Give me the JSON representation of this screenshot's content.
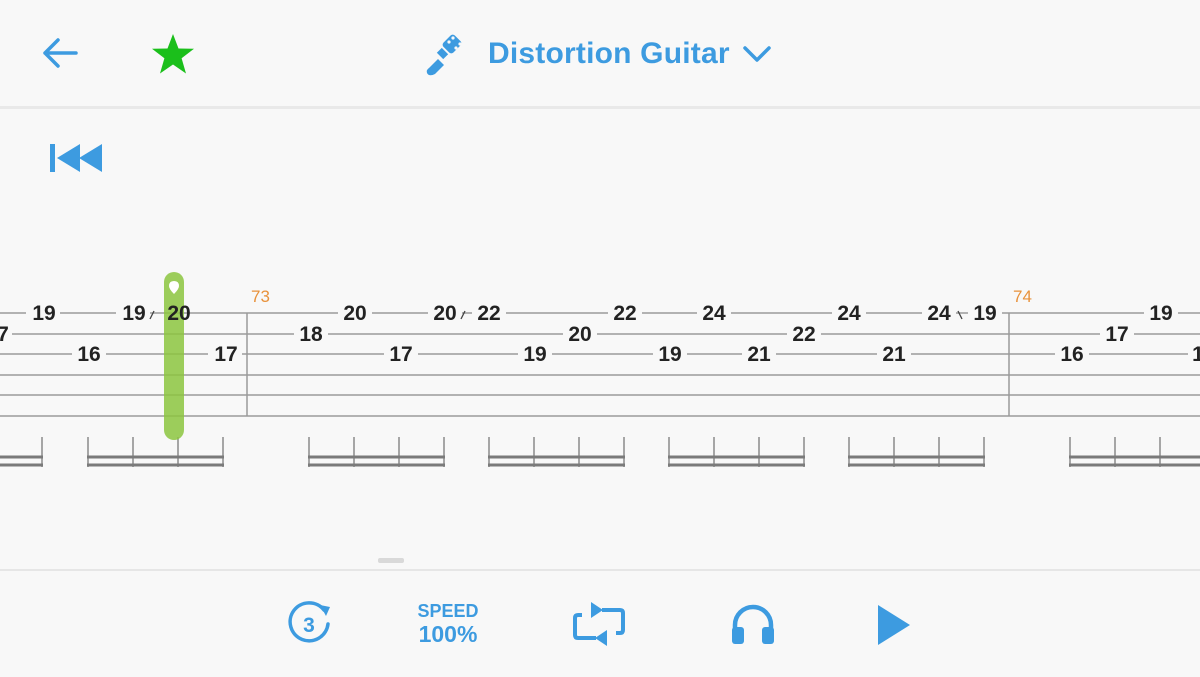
{
  "header": {
    "instrument_name": "Distortion Guitar",
    "back_icon": "arrow-left-icon",
    "favorite_icon": "star-icon",
    "instrument_icon": "electric-guitar-icon",
    "dropdown_icon": "chevron-down-icon"
  },
  "player": {
    "rewind_icon": "skip-to-start-icon"
  },
  "tablature": {
    "measure_numbers": [
      "73",
      "74"
    ],
    "notes": {
      "m72": [
        "7",
        "19",
        "16",
        "19",
        "20",
        "17"
      ],
      "m73": [
        "18",
        "20",
        "17",
        "20",
        "22",
        "19",
        "20",
        "22",
        "19",
        "24",
        "21",
        "22",
        "24",
        "21",
        "24",
        "19"
      ],
      "m74": [
        "16",
        "17",
        "19"
      ]
    }
  },
  "bottom_bar": {
    "countdown_value": "3",
    "speed_label": "SPEED",
    "speed_value": "100%",
    "loop_icon": "repeat-icon",
    "headphones_icon": "headphones-icon",
    "play_icon": "play-icon"
  },
  "colors": {
    "accent": "#3d9be0",
    "favorite": "#1bbf1b",
    "cursor": "#8cc63f",
    "measure_number": "#e8923c",
    "staff_line": "#9a9a9a"
  }
}
